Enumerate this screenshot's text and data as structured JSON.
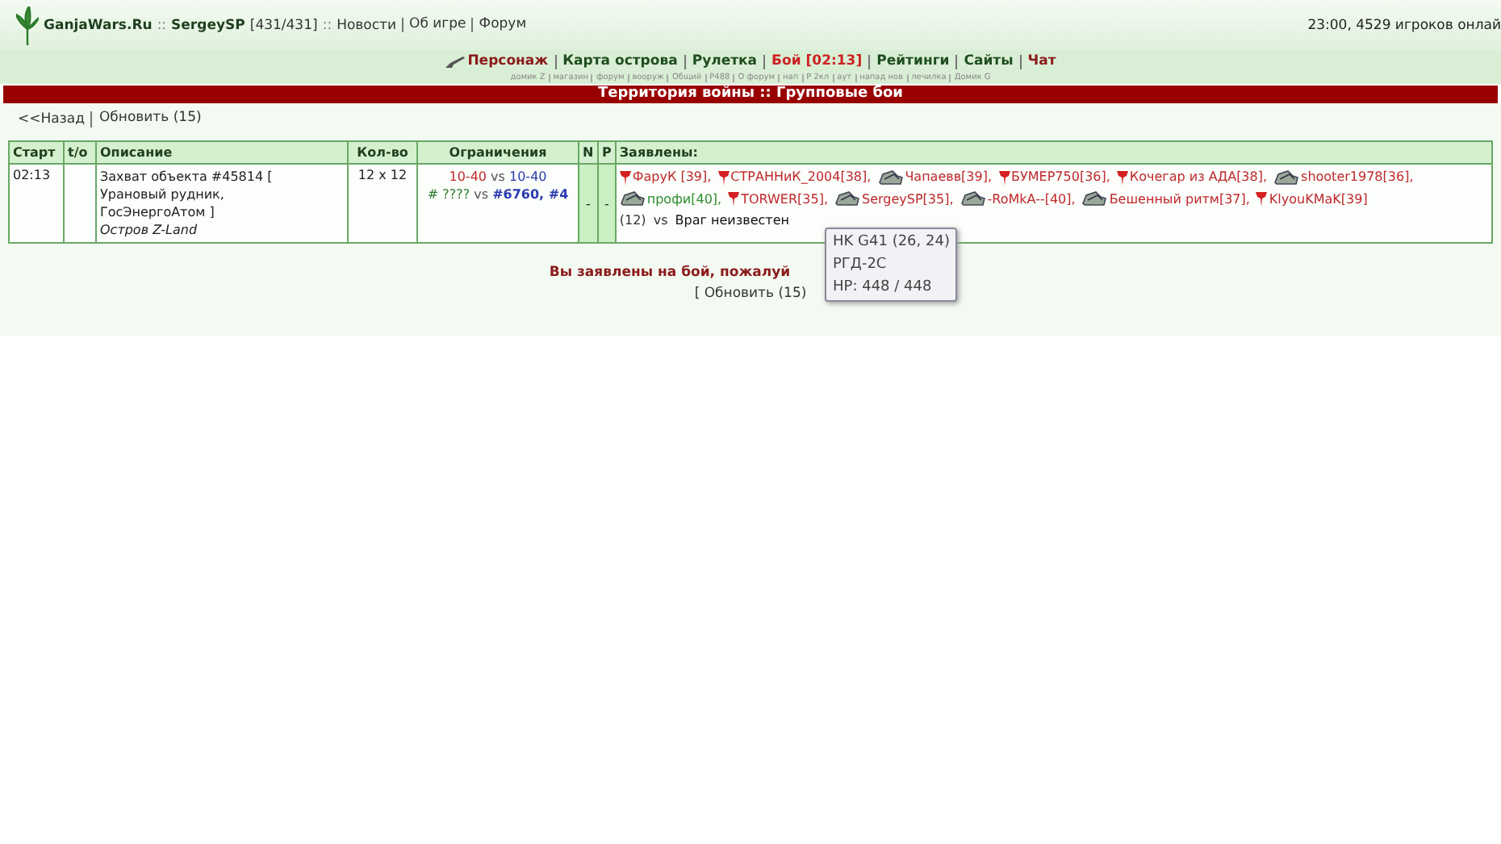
{
  "header": {
    "site": "GanjaWars.Ru",
    "sep1": "::",
    "user": "SergeySP",
    "hp": "[431/431]",
    "sep2": "::",
    "links": [
      "Новости",
      "Об игре",
      "Форум"
    ],
    "status": "23:00, 4529 игроков онлай"
  },
  "nav": [
    {
      "label": "Персонаж",
      "color": "#8b1a1a",
      "icon": true
    },
    {
      "label": "Карта острова",
      "color": "#1f4d1f",
      "icon": false
    },
    {
      "label": "Рулетка",
      "color": "#1f4d1f",
      "icon": false
    },
    {
      "label": "Бой [02:13]",
      "color": "#cc2222",
      "icon": false
    },
    {
      "label": "Рейтинги",
      "color": "#1f4d1f",
      "icon": false
    },
    {
      "label": "Сайты",
      "color": "#1f4d1f",
      "icon": false
    },
    {
      "label": "Чат",
      "color": "#8b1a1a",
      "icon": false
    }
  ],
  "sublinks": [
    "домик Z",
    "магазин",
    "форум",
    "вооруж",
    "Общий",
    "P488",
    "О форум",
    "нап",
    "P 2кл",
    "аут",
    "напад нов",
    "лечилка",
    "Домик G"
  ],
  "banner": "Территория войны :: Групповые бои",
  "actions": {
    "back": "<<Назад",
    "refresh": "Обновить (15)"
  },
  "table": {
    "columns": [
      "Старт",
      "t/o",
      "Описание",
      "Кол-во",
      "Ограничения",
      "N",
      "P",
      "Заявлены:"
    ],
    "rows": [
      {
        "start": "02:13",
        "to": "",
        "description": [
          "Захват объекта #45814 [",
          "Урановый рудник,",
          "ГосЭнергоАтом ]"
        ],
        "place": "Остров Z-Land",
        "count": "12 x 12",
        "limits": {
          "left": "10-40",
          "vs": "vs",
          "right": "10-40"
        },
        "clans": {
          "left": "# ????",
          "vs": "vs",
          "right": "#6760, #4"
        },
        "n": "-",
        "p": "-",
        "players": [
          {
            "kind": "pin",
            "name": "ФаруК [39],",
            "color": "#c0282d"
          },
          {
            "kind": "pin",
            "name": "СТРАННиК_2004[38],",
            "color": "#c0282d"
          },
          {
            "kind": "tank",
            "name": "Чапаевв[39],",
            "color": "#c0282d"
          },
          {
            "kind": "pin",
            "name": "БУМЕР750[36],",
            "color": "#c0282d"
          },
          {
            "kind": "pin",
            "name": "Кочегар из АДА[38],",
            "color": "#c0282d"
          },
          {
            "kind": "tank",
            "name": "shooter1978[36],",
            "color": "#c0282d"
          },
          {
            "kind": "tank",
            "name": "профи[40],",
            "color": "#2e8b2e"
          },
          {
            "kind": "pin",
            "name": "TORWER[35],",
            "color": "#c0282d"
          },
          {
            "kind": "tank",
            "name": "SergeySP[35],",
            "color": "#c0282d"
          },
          {
            "kind": "tank",
            "name": "-RoMkA--[40],",
            "color": "#c0282d"
          },
          {
            "kind": "tank",
            "name": "Бешенный ритм[37],",
            "color": "#c0282d"
          },
          {
            "kind": "pin",
            "name": "KlyouKMaK[39]",
            "color": "#c0282d"
          }
        ],
        "total": "(12)",
        "vs": "vs",
        "enemy": "Враг неизвестен"
      }
    ]
  },
  "notice": "Вы заявлены на бой, пожалуй",
  "refresh_bottom": "[ Обновить (15)",
  "tooltip": [
    "HK G41 (26, 24)",
    "РГД-2С",
    "HP: 448 / 448"
  ]
}
